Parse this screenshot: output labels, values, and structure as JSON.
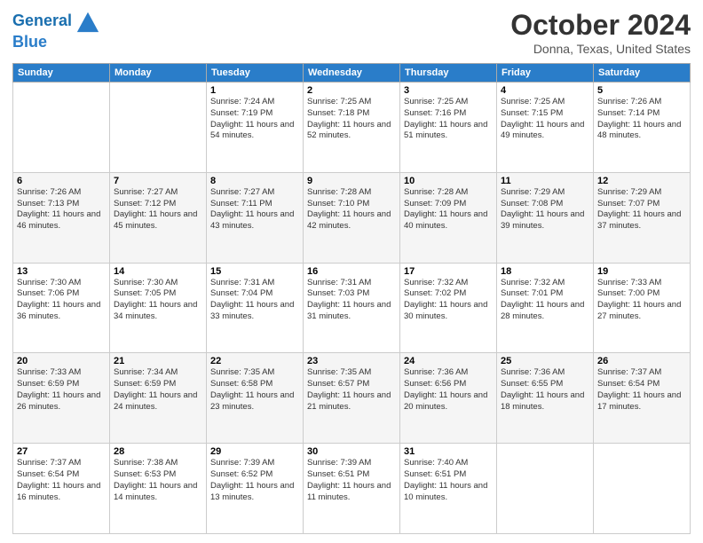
{
  "header": {
    "logo_line1": "General",
    "logo_line2": "Blue",
    "month_title": "October 2024",
    "location": "Donna, Texas, United States"
  },
  "days_of_week": [
    "Sunday",
    "Monday",
    "Tuesday",
    "Wednesday",
    "Thursday",
    "Friday",
    "Saturday"
  ],
  "weeks": [
    [
      {
        "day": "",
        "sunrise": "",
        "sunset": "",
        "daylight": ""
      },
      {
        "day": "",
        "sunrise": "",
        "sunset": "",
        "daylight": ""
      },
      {
        "day": "1",
        "sunrise": "Sunrise: 7:24 AM",
        "sunset": "Sunset: 7:19 PM",
        "daylight": "Daylight: 11 hours and 54 minutes."
      },
      {
        "day": "2",
        "sunrise": "Sunrise: 7:25 AM",
        "sunset": "Sunset: 7:18 PM",
        "daylight": "Daylight: 11 hours and 52 minutes."
      },
      {
        "day": "3",
        "sunrise": "Sunrise: 7:25 AM",
        "sunset": "Sunset: 7:16 PM",
        "daylight": "Daylight: 11 hours and 51 minutes."
      },
      {
        "day": "4",
        "sunrise": "Sunrise: 7:25 AM",
        "sunset": "Sunset: 7:15 PM",
        "daylight": "Daylight: 11 hours and 49 minutes."
      },
      {
        "day": "5",
        "sunrise": "Sunrise: 7:26 AM",
        "sunset": "Sunset: 7:14 PM",
        "daylight": "Daylight: 11 hours and 48 minutes."
      }
    ],
    [
      {
        "day": "6",
        "sunrise": "Sunrise: 7:26 AM",
        "sunset": "Sunset: 7:13 PM",
        "daylight": "Daylight: 11 hours and 46 minutes."
      },
      {
        "day": "7",
        "sunrise": "Sunrise: 7:27 AM",
        "sunset": "Sunset: 7:12 PM",
        "daylight": "Daylight: 11 hours and 45 minutes."
      },
      {
        "day": "8",
        "sunrise": "Sunrise: 7:27 AM",
        "sunset": "Sunset: 7:11 PM",
        "daylight": "Daylight: 11 hours and 43 minutes."
      },
      {
        "day": "9",
        "sunrise": "Sunrise: 7:28 AM",
        "sunset": "Sunset: 7:10 PM",
        "daylight": "Daylight: 11 hours and 42 minutes."
      },
      {
        "day": "10",
        "sunrise": "Sunrise: 7:28 AM",
        "sunset": "Sunset: 7:09 PM",
        "daylight": "Daylight: 11 hours and 40 minutes."
      },
      {
        "day": "11",
        "sunrise": "Sunrise: 7:29 AM",
        "sunset": "Sunset: 7:08 PM",
        "daylight": "Daylight: 11 hours and 39 minutes."
      },
      {
        "day": "12",
        "sunrise": "Sunrise: 7:29 AM",
        "sunset": "Sunset: 7:07 PM",
        "daylight": "Daylight: 11 hours and 37 minutes."
      }
    ],
    [
      {
        "day": "13",
        "sunrise": "Sunrise: 7:30 AM",
        "sunset": "Sunset: 7:06 PM",
        "daylight": "Daylight: 11 hours and 36 minutes."
      },
      {
        "day": "14",
        "sunrise": "Sunrise: 7:30 AM",
        "sunset": "Sunset: 7:05 PM",
        "daylight": "Daylight: 11 hours and 34 minutes."
      },
      {
        "day": "15",
        "sunrise": "Sunrise: 7:31 AM",
        "sunset": "Sunset: 7:04 PM",
        "daylight": "Daylight: 11 hours and 33 minutes."
      },
      {
        "day": "16",
        "sunrise": "Sunrise: 7:31 AM",
        "sunset": "Sunset: 7:03 PM",
        "daylight": "Daylight: 11 hours and 31 minutes."
      },
      {
        "day": "17",
        "sunrise": "Sunrise: 7:32 AM",
        "sunset": "Sunset: 7:02 PM",
        "daylight": "Daylight: 11 hours and 30 minutes."
      },
      {
        "day": "18",
        "sunrise": "Sunrise: 7:32 AM",
        "sunset": "Sunset: 7:01 PM",
        "daylight": "Daylight: 11 hours and 28 minutes."
      },
      {
        "day": "19",
        "sunrise": "Sunrise: 7:33 AM",
        "sunset": "Sunset: 7:00 PM",
        "daylight": "Daylight: 11 hours and 27 minutes."
      }
    ],
    [
      {
        "day": "20",
        "sunrise": "Sunrise: 7:33 AM",
        "sunset": "Sunset: 6:59 PM",
        "daylight": "Daylight: 11 hours and 26 minutes."
      },
      {
        "day": "21",
        "sunrise": "Sunrise: 7:34 AM",
        "sunset": "Sunset: 6:59 PM",
        "daylight": "Daylight: 11 hours and 24 minutes."
      },
      {
        "day": "22",
        "sunrise": "Sunrise: 7:35 AM",
        "sunset": "Sunset: 6:58 PM",
        "daylight": "Daylight: 11 hours and 23 minutes."
      },
      {
        "day": "23",
        "sunrise": "Sunrise: 7:35 AM",
        "sunset": "Sunset: 6:57 PM",
        "daylight": "Daylight: 11 hours and 21 minutes."
      },
      {
        "day": "24",
        "sunrise": "Sunrise: 7:36 AM",
        "sunset": "Sunset: 6:56 PM",
        "daylight": "Daylight: 11 hours and 20 minutes."
      },
      {
        "day": "25",
        "sunrise": "Sunrise: 7:36 AM",
        "sunset": "Sunset: 6:55 PM",
        "daylight": "Daylight: 11 hours and 18 minutes."
      },
      {
        "day": "26",
        "sunrise": "Sunrise: 7:37 AM",
        "sunset": "Sunset: 6:54 PM",
        "daylight": "Daylight: 11 hours and 17 minutes."
      }
    ],
    [
      {
        "day": "27",
        "sunrise": "Sunrise: 7:37 AM",
        "sunset": "Sunset: 6:54 PM",
        "daylight": "Daylight: 11 hours and 16 minutes."
      },
      {
        "day": "28",
        "sunrise": "Sunrise: 7:38 AM",
        "sunset": "Sunset: 6:53 PM",
        "daylight": "Daylight: 11 hours and 14 minutes."
      },
      {
        "day": "29",
        "sunrise": "Sunrise: 7:39 AM",
        "sunset": "Sunset: 6:52 PM",
        "daylight": "Daylight: 11 hours and 13 minutes."
      },
      {
        "day": "30",
        "sunrise": "Sunrise: 7:39 AM",
        "sunset": "Sunset: 6:51 PM",
        "daylight": "Daylight: 11 hours and 11 minutes."
      },
      {
        "day": "31",
        "sunrise": "Sunrise: 7:40 AM",
        "sunset": "Sunset: 6:51 PM",
        "daylight": "Daylight: 11 hours and 10 minutes."
      },
      {
        "day": "",
        "sunrise": "",
        "sunset": "",
        "daylight": ""
      },
      {
        "day": "",
        "sunrise": "",
        "sunset": "",
        "daylight": ""
      }
    ]
  ]
}
